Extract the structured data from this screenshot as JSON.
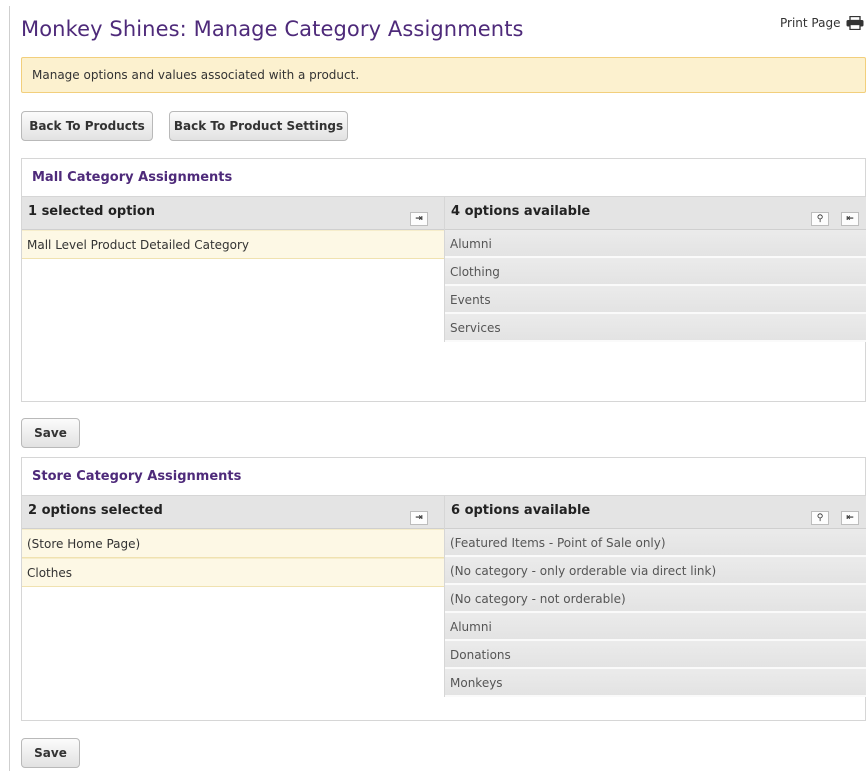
{
  "page": {
    "title": "Monkey Shines: Manage Category Assignments",
    "print_label": "Print Page",
    "notice": "Manage options and values associated with a product."
  },
  "buttons": {
    "back_to_products": "Back To Products",
    "back_to_settings": "Back To Product Settings",
    "save": "Save"
  },
  "mall": {
    "header": "Mall Category Assignments",
    "selected_title": "1 selected option",
    "available_title": "4 options available",
    "selected": [
      "Mall Level Product Detailed Category"
    ],
    "available": [
      "Alumni",
      "Clothing",
      "Events",
      "Services"
    ]
  },
  "store": {
    "header": "Store Category Assignments",
    "selected_title": "2 options selected",
    "available_title": "6 options available",
    "selected": [
      "(Store Home Page)",
      "Clothes"
    ],
    "available": [
      "(Featured Items - Point of Sale only)",
      "(No category - only orderable via direct link)",
      "(No category - not orderable)",
      "Alumni",
      "Donations",
      "Monkeys"
    ]
  },
  "icons": {
    "print": "printer-icon",
    "move_all": "arrow-to-right-icon",
    "search": "search-icon",
    "move_back": "arrow-to-left-icon"
  },
  "colors": {
    "title": "#4e2a7a",
    "notice_bg": "#fcf1cf",
    "notice_border": "#f2cf7c",
    "selected_bg": "#fdf8e5",
    "column_header_bg": "#e4e4e4"
  }
}
